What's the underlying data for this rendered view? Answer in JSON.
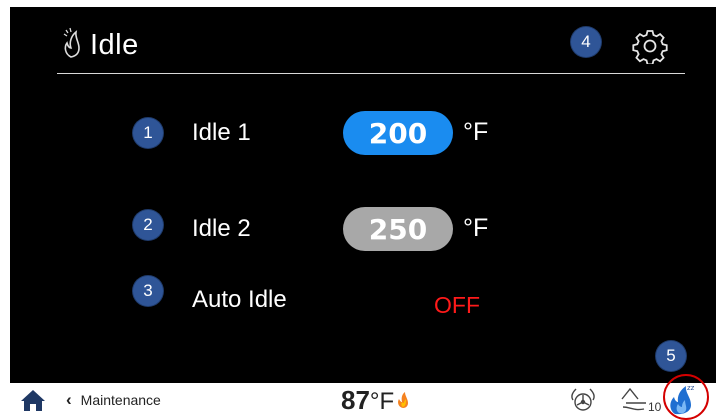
{
  "header": {
    "title": "Idle",
    "flame_icon": "flame-outline-icon",
    "settings_icon": "gear-icon"
  },
  "rows": [
    {
      "label": "Idle 1",
      "value": "200",
      "unit": "°F",
      "state": "active"
    },
    {
      "label": "Idle 2",
      "value": "250",
      "unit": "°F",
      "state": "inactive"
    }
  ],
  "auto_idle": {
    "label": "Auto Idle",
    "value": "OFF"
  },
  "callouts": [
    "1",
    "2",
    "3",
    "4",
    "5"
  ],
  "footer": {
    "back_label": "Maintenance",
    "temperature": "87",
    "temperature_unit": "°F",
    "steam_count": "10",
    "icons": [
      "home-icon",
      "chevron-left-icon",
      "flame-icon",
      "fan-icon",
      "steam-icon",
      "idle-mode-icon"
    ]
  },
  "colors": {
    "background": "#000000",
    "accent": "#1a8cf0",
    "inactive_pill": "#a8a8a8",
    "off_text": "#ff1a1a",
    "callout": "#2f5597",
    "highlight": "#d40000"
  }
}
